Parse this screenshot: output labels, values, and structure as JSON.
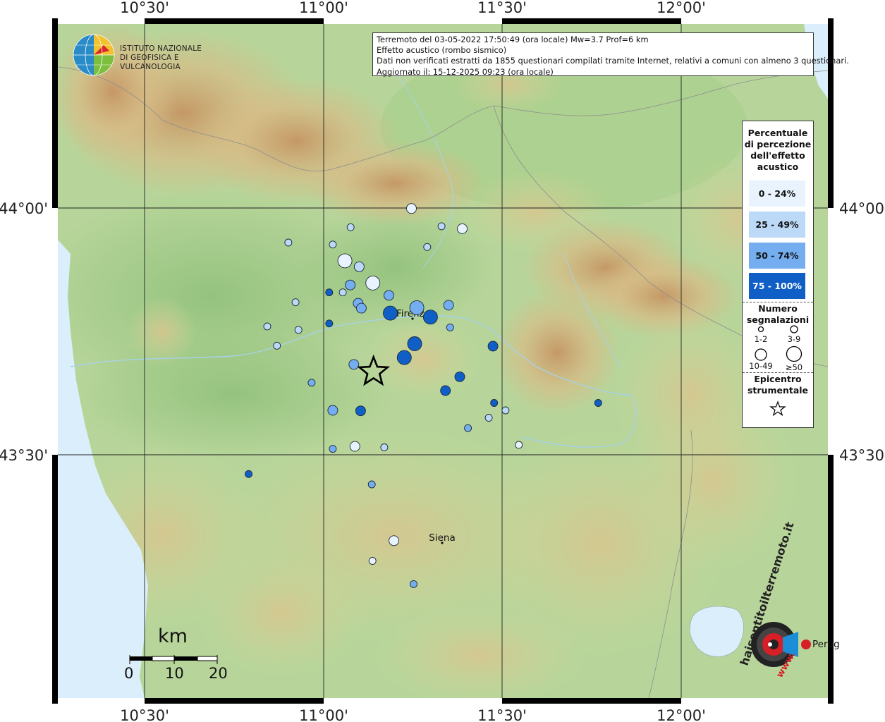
{
  "info": {
    "line1": "Terremoto del 03-05-2022 17:50:49 (ora locale) Mw=3.7 Prof=6 km",
    "line2": "Effetto acustico (rombo sismico)",
    "line3": "Dati non verificati estratti da 1855 questionari compilati tramite Internet, relativi a comuni con almeno 3 questionari.",
    "line4": "Aggiornato il: 15-12-2025 09:23 (ora locale)"
  },
  "axes": {
    "top": [
      "10°30'",
      "11°00'",
      "11°30'",
      "12°00'"
    ],
    "bottom": [
      "10°30'",
      "11°00'",
      "11°30'",
      "12°00'"
    ],
    "left": [
      "44°00'",
      "43°30'"
    ],
    "right": [
      "44°00'",
      "43°30'"
    ]
  },
  "logo": {
    "line1": "ISTITUTO NAZIONALE",
    "line2": "DI GEOFISICA E VULCANOLOGIA"
  },
  "legend": {
    "title": "Percentuale di percezione dell'effetto acustico",
    "classes": [
      {
        "label": "0 - 24%",
        "color": "#e8f3fd"
      },
      {
        "label": "25 - 49%",
        "color": "#bcd9f7"
      },
      {
        "label": "50 - 74%",
        "color": "#74aef0"
      },
      {
        "label": "75 - 100%",
        "color": "#0f5fc7"
      }
    ],
    "count_title": "Numero segnalazioni",
    "counts": [
      "1-2",
      "3-9",
      "10-49",
      "≥50"
    ],
    "epicenter_title": "Epicentro strumentale"
  },
  "scale": {
    "unit": "km",
    "ticks": [
      "0",
      "10",
      "20"
    ]
  },
  "cities": [
    {
      "name": "Firenze"
    },
    {
      "name": "Siena"
    },
    {
      "name": "Perug"
    }
  ],
  "watermark": {
    "text": "haisentitoilterremoto.it",
    "url": "www."
  },
  "points": [
    {
      "lon": 11.246,
      "lat": 43.999,
      "size": "s",
      "cls": 0
    },
    {
      "lon": 11.076,
      "lat": 43.961,
      "size": "xs",
      "cls": 1
    },
    {
      "lon": 11.33,
      "lat": 43.963,
      "size": "xs",
      "cls": 1
    },
    {
      "lon": 11.388,
      "lat": 43.958,
      "size": "s",
      "cls": 0
    },
    {
      "lon": 10.902,
      "lat": 43.93,
      "size": "xs",
      "cls": 1
    },
    {
      "lon": 11.026,
      "lat": 43.926,
      "size": "xs",
      "cls": 1
    },
    {
      "lon": 11.29,
      "lat": 43.921,
      "size": "xs",
      "cls": 1
    },
    {
      "lon": 11.06,
      "lat": 43.893,
      "size": "m",
      "cls": 0
    },
    {
      "lon": 11.1,
      "lat": 43.881,
      "size": "s",
      "cls": 1
    },
    {
      "lon": 11.138,
      "lat": 43.848,
      "size": "m",
      "cls": 0
    },
    {
      "lon": 11.075,
      "lat": 43.844,
      "size": "s",
      "cls": 2
    },
    {
      "lon": 11.016,
      "lat": 43.829,
      "size": "xs",
      "cls": 3
    },
    {
      "lon": 11.054,
      "lat": 43.829,
      "size": "xs",
      "cls": 1
    },
    {
      "lon": 11.183,
      "lat": 43.823,
      "size": "s",
      "cls": 2
    },
    {
      "lon": 10.922,
      "lat": 43.809,
      "size": "xs",
      "cls": 1
    },
    {
      "lon": 11.097,
      "lat": 43.807,
      "size": "s",
      "cls": 2
    },
    {
      "lon": 11.106,
      "lat": 43.797,
      "size": "s",
      "cls": 2
    },
    {
      "lon": 11.261,
      "lat": 43.798,
      "size": "m",
      "cls": 2
    },
    {
      "lon": 11.35,
      "lat": 43.803,
      "size": "s",
      "cls": 2
    },
    {
      "lon": 11.187,
      "lat": 43.787,
      "size": "m",
      "cls": 3
    },
    {
      "lon": 11.299,
      "lat": 43.779,
      "size": "m",
      "cls": 3
    },
    {
      "lon": 11.016,
      "lat": 43.766,
      "size": "xs",
      "cls": 3
    },
    {
      "lon": 10.843,
      "lat": 43.76,
      "size": "xs",
      "cls": 1
    },
    {
      "lon": 10.93,
      "lat": 43.753,
      "size": "xs",
      "cls": 1
    },
    {
      "lon": 11.354,
      "lat": 43.758,
      "size": "xs",
      "cls": 2
    },
    {
      "lon": 11.255,
      "lat": 43.725,
      "size": "m",
      "cls": 3
    },
    {
      "lon": 10.87,
      "lat": 43.721,
      "size": "xs",
      "cls": 1
    },
    {
      "lon": 11.474,
      "lat": 43.72,
      "size": "s",
      "cls": 3
    },
    {
      "lon": 11.226,
      "lat": 43.697,
      "size": "m",
      "cls": 3
    },
    {
      "lon": 11.085,
      "lat": 43.683,
      "size": "s",
      "cls": 2
    },
    {
      "lon": 11.381,
      "lat": 43.658,
      "size": "s",
      "cls": 3
    },
    {
      "lon": 10.967,
      "lat": 43.646,
      "size": "xs",
      "cls": 2
    },
    {
      "lon": 11.341,
      "lat": 43.63,
      "size": "s",
      "cls": 3
    },
    {
      "lon": 11.477,
      "lat": 43.605,
      "size": "xs",
      "cls": 3
    },
    {
      "lon": 11.768,
      "lat": 43.605,
      "size": "xs",
      "cls": 3
    },
    {
      "lon": 11.026,
      "lat": 43.59,
      "size": "s",
      "cls": 2
    },
    {
      "lon": 11.104,
      "lat": 43.589,
      "size": "s",
      "cls": 3
    },
    {
      "lon": 11.509,
      "lat": 43.59,
      "size": "xs",
      "cls": 1
    },
    {
      "lon": 11.462,
      "lat": 43.575,
      "size": "xs",
      "cls": 1
    },
    {
      "lon": 11.404,
      "lat": 43.554,
      "size": "xs",
      "cls": 2
    },
    {
      "lon": 11.546,
      "lat": 43.52,
      "size": "xs",
      "cls": 0
    },
    {
      "lon": 11.088,
      "lat": 43.517,
      "size": "s",
      "cls": 0
    },
    {
      "lon": 11.17,
      "lat": 43.515,
      "size": "xs",
      "cls": 1
    },
    {
      "lon": 11.026,
      "lat": 43.512,
      "size": "xs",
      "cls": 2
    },
    {
      "lon": 10.791,
      "lat": 43.461,
      "size": "xs",
      "cls": 3
    },
    {
      "lon": 11.135,
      "lat": 43.44,
      "size": "xs",
      "cls": 2
    },
    {
      "lon": 11.197,
      "lat": 43.326,
      "size": "s",
      "cls": 0
    },
    {
      "lon": 11.137,
      "lat": 43.285,
      "size": "xs",
      "cls": 0
    },
    {
      "lon": 11.252,
      "lat": 43.238,
      "size": "xs",
      "cls": 2
    }
  ],
  "epicenter": {
    "lon": 11.14,
    "lat": 43.668
  }
}
